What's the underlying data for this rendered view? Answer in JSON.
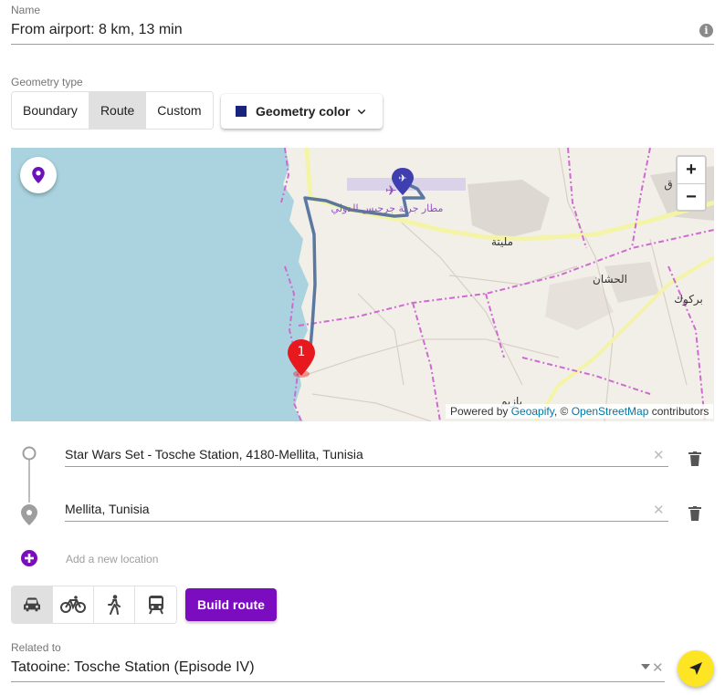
{
  "name_field": {
    "label": "Name",
    "value": "From airport: 8 km, 13 min"
  },
  "geometry": {
    "label": "Geometry type",
    "options": [
      "Boundary",
      "Route",
      "Custom"
    ],
    "selected": "Route",
    "color_button": "Geometry color",
    "color": "#1a237e"
  },
  "map": {
    "attribution": {
      "prefix": "Powered by ",
      "geoapify": "Geoapify",
      "sep": ", © ",
      "osm": "OpenStreetMap",
      "suffix": " contributors"
    },
    "zoom_in": "+",
    "zoom_out": "−",
    "marker_number": "1",
    "place_labels": {
      "airport": "مطار جربة جرجيس الدولي",
      "melita": "مليتة",
      "hachane": "الحشان",
      "arkoub": "بركوك",
      "bazim": "بازيم",
      "top_right": "ق"
    },
    "colors": {
      "sea": "#aad3df",
      "land": "#f2efe9",
      "route": "#4a6a9a",
      "boundary": "#cf6ad0",
      "road": "#f4f4a8",
      "marker": "#e8191e",
      "pin": "#6b12b8"
    }
  },
  "locations": [
    {
      "value": "Star Wars Set - Tosche Station, 4180-Mellita, Tunisia"
    },
    {
      "value": "Mellita, Tunisia"
    }
  ],
  "add_location": "Add a new location",
  "travel_modes": [
    "car-icon",
    "bicycle-icon",
    "walk-icon",
    "transit-icon"
  ],
  "selected_mode": "car-icon",
  "build_route": "Build route",
  "related_field": {
    "label": "Related to",
    "value": "Tatooine: Tosche Station (Episode IV)"
  },
  "accent": "#7b0cc0",
  "fab_color": "#fde523"
}
